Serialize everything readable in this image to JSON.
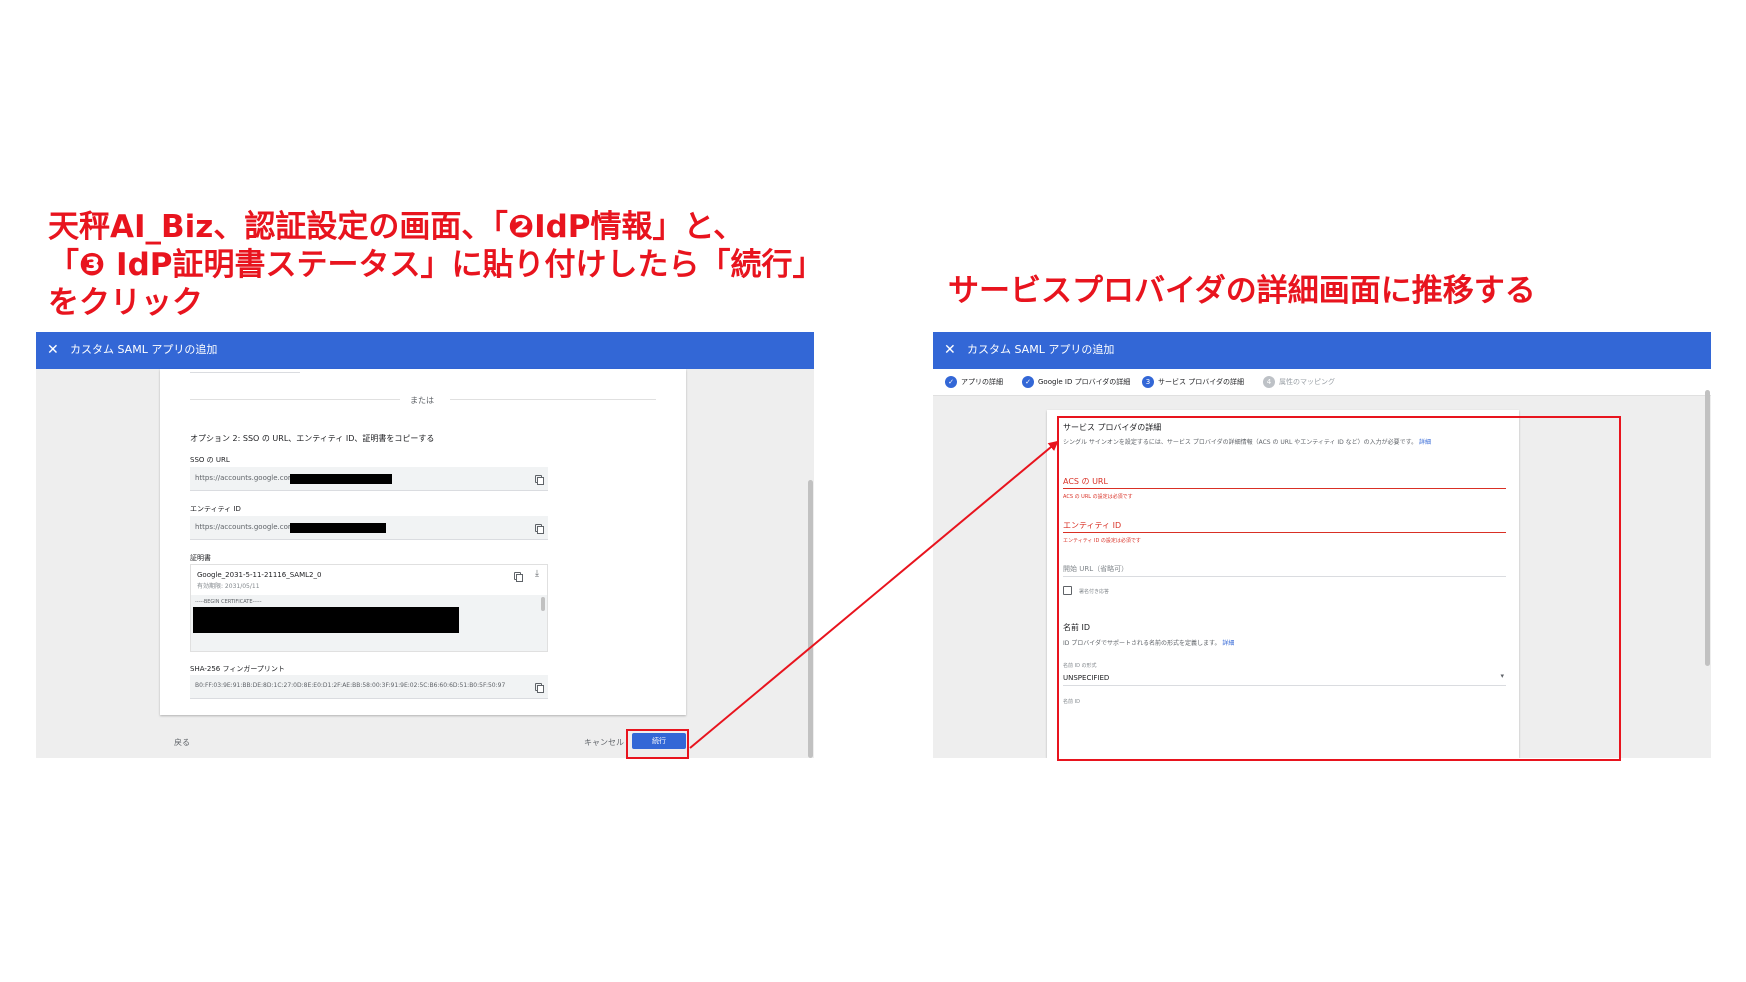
{
  "captions": {
    "left_line1": "天秤AI_Biz、認証設定の画面、「❷IdP情報」と、",
    "left_line2": "「❸ IdP証明書ステータス」に貼り付けしたら「続行」",
    "left_line3": "をクリック",
    "right": "サービスプロバイダの詳細画面に推移する"
  },
  "left_window": {
    "close_glyph": "✕",
    "title": "カスタム SAML アプリの追加",
    "divider_text": "または",
    "option_heading": "オプション 2: SSO の URL、エンティティ ID、証明書をコピーする",
    "sso_url_label": "SSO の URL",
    "sso_url_value": "https://accounts.google.com/",
    "entity_id_label": "エンティティ ID",
    "entity_id_value": "https://accounts.google.com/",
    "cert_label": "証明書",
    "cert_name": "Google_2031-5-11-21116_SAML2_0",
    "cert_expiry": "有効期限: 2031/05/11",
    "cert_begin": "-----BEGIN CERTIFICATE-----",
    "fingerprint_label": "SHA-256 フィンガープリント",
    "fingerprint_value": "B0:FF:03:9E:91:BB:DE:8D:1C:27:0D:8E:E0:D1:2F:AE:BB:58:00:3F:91:9E:02:5C:B6:60:6D:51:B0:5F:50:97",
    "back_label": "戻る",
    "cancel_label": "キャンセル",
    "continue_label": "続行"
  },
  "right_window": {
    "close_glyph": "✕",
    "title": "カスタム SAML アプリの追加",
    "steps": [
      {
        "num": "✓",
        "label": "アプリの詳細"
      },
      {
        "num": "✓",
        "label": "Google ID プロバイダの詳細"
      },
      {
        "num": "3",
        "label": "サービス プロバイダの詳細"
      },
      {
        "num": "4",
        "label": "属性のマッピング"
      }
    ],
    "section_title": "サービス プロバイダの詳細",
    "section_desc": "シングル サインオンを設定するには、サービス プロバイダの詳細情報（ACS の URL やエンティティ ID など）の入力が必要です。",
    "details_link": "詳細",
    "acs_label": "ACS の URL",
    "acs_error": "ACS の URL の設定は必須です",
    "entity_label": "エンティティ ID",
    "entity_error": "エンティティ ID の設定は必須です",
    "start_url_label": "開始 URL（省略可）",
    "signed_response_label": "署名付き応答",
    "nameid_title": "名前 ID",
    "nameid_desc": "ID プロバイダでサポートされる名前の形式を定義します。",
    "nameid_link": "詳細",
    "nameid_format_label": "名前 ID の形式",
    "nameid_format_value": "UNSPECIFIED",
    "nameid_label": "名前 ID"
  },
  "colors": {
    "caption_red": "#e8141e",
    "header_blue": "#3367d6",
    "error_red": "#d93025"
  }
}
